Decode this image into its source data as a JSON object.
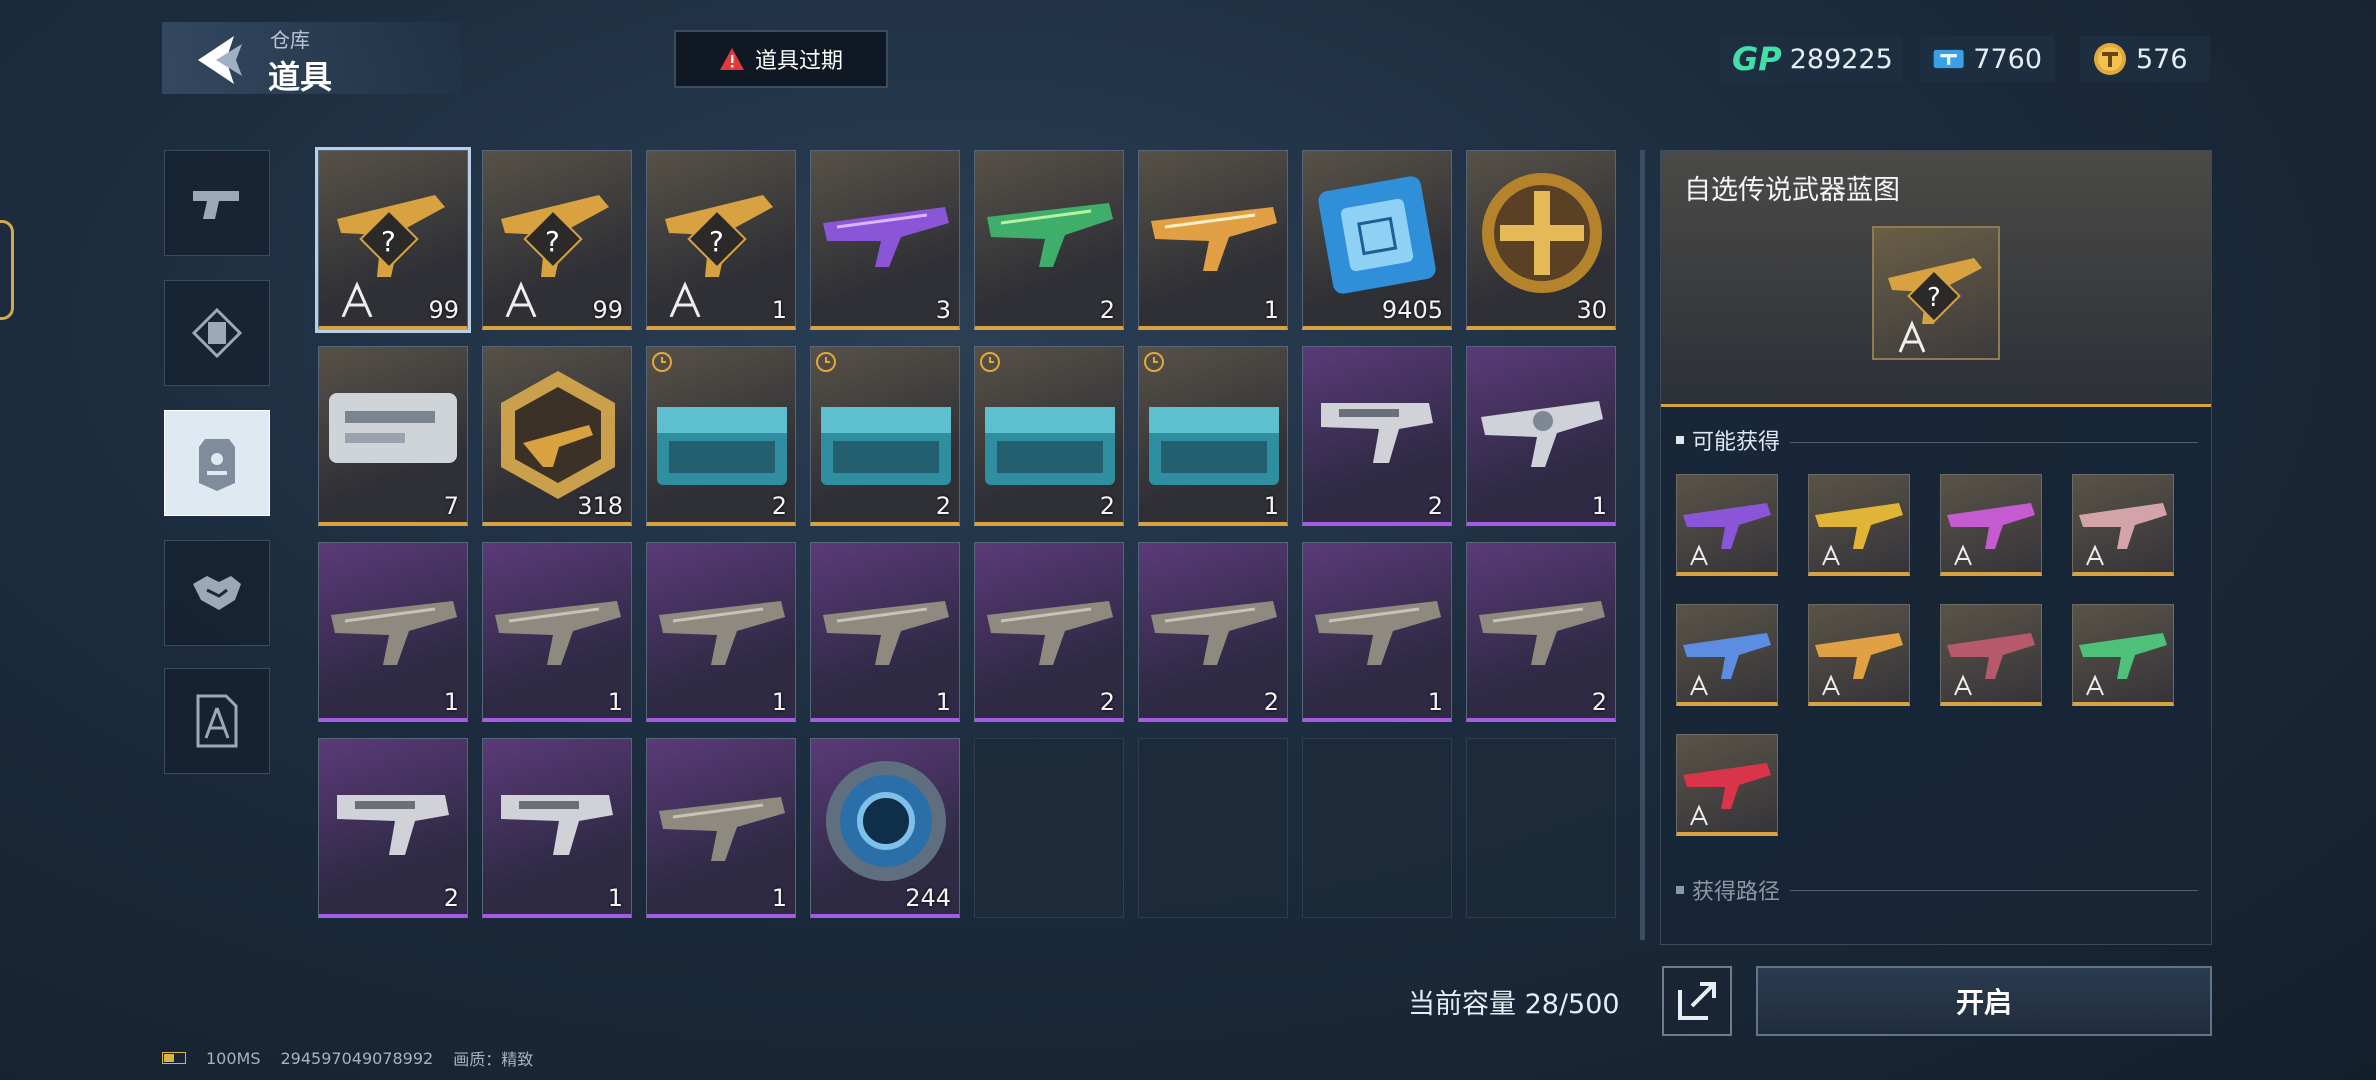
{
  "header": {
    "breadcrumb_parent": "仓库",
    "breadcrumb_current": "道具",
    "expire_button": "道具过期"
  },
  "currencies": [
    {
      "icon": "gp-icon",
      "value": "289225"
    },
    {
      "icon": "ticket-icon",
      "value": "7760"
    },
    {
      "icon": "coin-icon",
      "value": "576"
    }
  ],
  "categories": [
    {
      "icon": "pistol-icon",
      "active": false
    },
    {
      "icon": "frame-icon",
      "active": false
    },
    {
      "icon": "tag-icon",
      "active": true
    },
    {
      "icon": "handshake-icon",
      "active": false
    },
    {
      "icon": "blueprint-icon",
      "active": false
    }
  ],
  "items": [
    {
      "qty": "99",
      "rarity": "gold",
      "art": "blueprint-rifle",
      "timed": false,
      "selected": true
    },
    {
      "qty": "99",
      "rarity": "gold",
      "art": "blueprint-rifle",
      "timed": false
    },
    {
      "qty": "1",
      "rarity": "gold",
      "art": "blueprint-rifle",
      "timed": false
    },
    {
      "qty": "3",
      "rarity": "gold",
      "art": "purple-rifle",
      "timed": false
    },
    {
      "qty": "2",
      "rarity": "gold",
      "art": "green-rifle",
      "timed": false
    },
    {
      "qty": "1",
      "rarity": "gold",
      "art": "gold-rifle",
      "timed": false
    },
    {
      "qty": "9405",
      "rarity": "gold",
      "art": "chip",
      "timed": false
    },
    {
      "qty": "30",
      "rarity": "gold",
      "art": "gold-medal",
      "timed": false
    },
    {
      "qty": "7",
      "rarity": "gold",
      "art": "silver-case",
      "timed": false
    },
    {
      "qty": "318",
      "rarity": "gold",
      "art": "hex-badge",
      "timed": false
    },
    {
      "qty": "2",
      "rarity": "gold",
      "art": "crate",
      "timed": true
    },
    {
      "qty": "2",
      "rarity": "gold",
      "art": "crate",
      "timed": true
    },
    {
      "qty": "2",
      "rarity": "gold",
      "art": "crate",
      "timed": true
    },
    {
      "qty": "1",
      "rarity": "gold",
      "art": "crate",
      "timed": true
    },
    {
      "qty": "2",
      "rarity": "purple",
      "art": "smg",
      "timed": false
    },
    {
      "qty": "1",
      "rarity": "purple",
      "art": "silver-rifle",
      "timed": false
    },
    {
      "qty": "1",
      "rarity": "purple",
      "art": "rifle",
      "timed": false
    },
    {
      "qty": "1",
      "rarity": "purple",
      "art": "rifle",
      "timed": false
    },
    {
      "qty": "1",
      "rarity": "purple",
      "art": "rifle",
      "timed": false
    },
    {
      "qty": "1",
      "rarity": "purple",
      "art": "rifle",
      "timed": false
    },
    {
      "qty": "2",
      "rarity": "purple",
      "art": "rifle",
      "timed": false
    },
    {
      "qty": "2",
      "rarity": "purple",
      "art": "rifle",
      "timed": false
    },
    {
      "qty": "1",
      "rarity": "purple",
      "art": "rifle",
      "timed": false
    },
    {
      "qty": "2",
      "rarity": "purple",
      "art": "rifle",
      "timed": false
    },
    {
      "qty": "2",
      "rarity": "purple",
      "art": "smg",
      "timed": false
    },
    {
      "qty": "1",
      "rarity": "purple",
      "art": "smg",
      "timed": false
    },
    {
      "qty": "1",
      "rarity": "purple",
      "art": "rifle",
      "timed": false
    },
    {
      "qty": "244",
      "rarity": "purple",
      "art": "blue-token",
      "timed": false
    }
  ],
  "capacity_text": "当前容量 28/500",
  "detail": {
    "title": "自选传说武器蓝图",
    "possible_header": "可能获得",
    "source_header": "获得路径",
    "rewards": [
      {
        "color": "#8a55d6"
      },
      {
        "color": "#e0b437"
      },
      {
        "color": "#c65ad0"
      },
      {
        "color": "#d2a3a8"
      },
      {
        "color": "#5c8de0"
      },
      {
        "color": "#e2a044"
      },
      {
        "color": "#b65a6b"
      },
      {
        "color": "#4fc07a"
      },
      {
        "color": "#d8344a"
      }
    ],
    "open_button": "开启"
  },
  "status_bar": {
    "ping": "100MS",
    "uid": "294597049078992",
    "quality": "画质：精致"
  },
  "colors": {
    "gold": "#d7a23f",
    "purple": "#a45ce0",
    "gp": "#42e0a8"
  }
}
